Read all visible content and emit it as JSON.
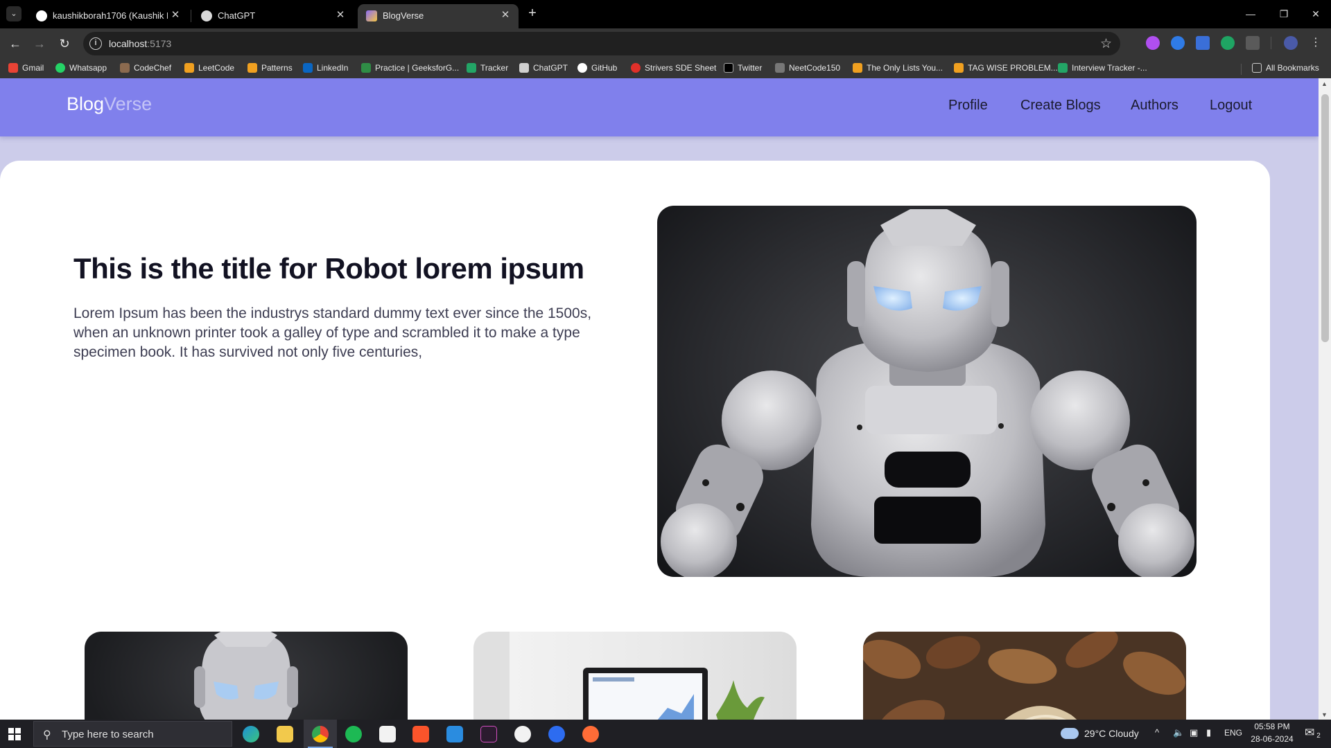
{
  "browser": {
    "tabs": [
      {
        "title": "kaushikborah1706 (Kaushik Bor",
        "active": false
      },
      {
        "title": "ChatGPT",
        "active": false
      },
      {
        "title": "BlogVerse",
        "active": true
      }
    ],
    "url": {
      "host": "localhost",
      "port": ":5173"
    },
    "bookmarks": [
      "Gmail",
      "Whatsapp",
      "CodeChef",
      "LeetCode",
      "Patterns",
      "LinkedIn",
      "Practice | GeeksforG...",
      "Tracker",
      "ChatGPT",
      "GitHub",
      "Strivers SDE Sheet",
      "Twitter",
      "NeetCode150",
      "The Only Lists You...",
      "TAG WISE PROBLEM...",
      "Interview Tracker -..."
    ],
    "all_bookmarks": "All Bookmarks"
  },
  "site": {
    "logo_part1": "Blog",
    "logo_part2": "Verse",
    "nav": [
      "Profile",
      "Create Blogs",
      "Authors",
      "Logout"
    ]
  },
  "hero": {
    "title": "This is the title for Robot lorem ipsum",
    "text": "Lorem Ipsum has been the industrys standard dummy text ever since the 1500s, when an unknown printer took a galley of type and scrambled it to make a type specimen book. It has survived not only five centuries,"
  },
  "taskbar": {
    "search_placeholder": "Type here to search",
    "weather": "29°C  Cloudy",
    "lang": "ENG",
    "time": "05:58 PM",
    "date": "28-06-2024",
    "notif_count": "2"
  },
  "colors": {
    "nav_bg": "#8080ec",
    "page_bg": "#ccccea",
    "logo_secondary": "#c4c4f6",
    "card_bg": "#ffffff"
  }
}
